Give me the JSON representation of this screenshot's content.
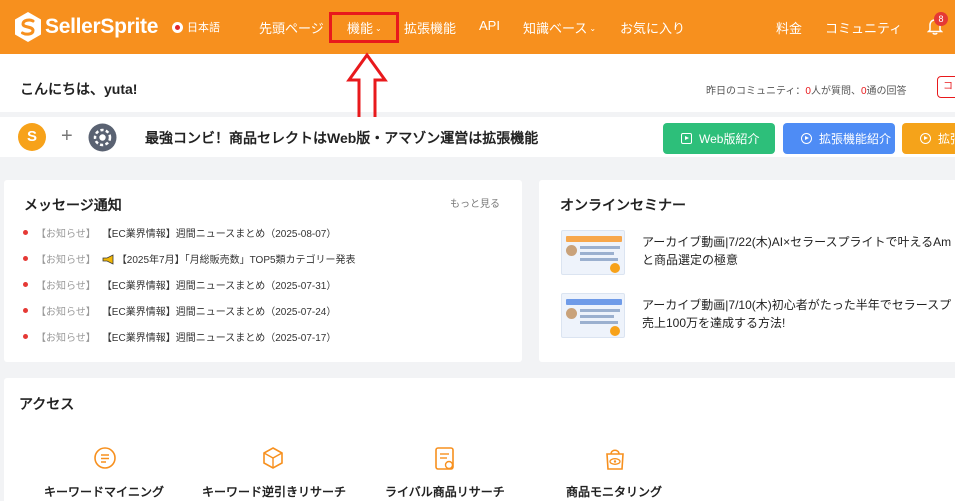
{
  "brand": {
    "name": "SellerSprite",
    "accent_color": "#f7901e",
    "highlight_color": "#e8191c"
  },
  "header": {
    "language": "日本語",
    "nav": [
      {
        "label": "先頭ページ"
      },
      {
        "label": "機能"
      },
      {
        "label": "拡張機能"
      },
      {
        "label": "API"
      },
      {
        "label": "知識ベース"
      },
      {
        "label": "お気に入り"
      },
      {
        "label": "料金"
      },
      {
        "label": "コミュニティ"
      }
    ],
    "notification_count": "8"
  },
  "greeting": {
    "text": "こんにちは、yuta!",
    "community_prefix": "昨日のコミュニティ：",
    "questions_count": "0",
    "questions_suffix": "人が質問、",
    "answers_count": "0",
    "answers_suffix": "通の回答",
    "edge_button": "コ"
  },
  "banner": {
    "plus": "+",
    "text": "最強コンビ！商品セレクトはWeb版・アマゾン運営は拡張機能",
    "buttons": [
      {
        "label": "Web版紹介",
        "color": "#2dbf7a"
      },
      {
        "label": "拡張機能紹介",
        "color": "#4e8cf5"
      },
      {
        "label": "拡張",
        "color": "#f5a31a"
      }
    ]
  },
  "messages": {
    "title": "メッセージ通知",
    "more": "もっと見る",
    "items": [
      {
        "tag": "【お知らせ】",
        "text": "【EC業界情報】週間ニュースまとめ（2025-08-07）"
      },
      {
        "tag": "【お知らせ】",
        "text": "【2025年7月】「月総販売数」TOP5類カテゴリー発表"
      },
      {
        "tag": "【お知らせ】",
        "text": "【EC業界情報】週間ニュースまとめ（2025-07-31）"
      },
      {
        "tag": "【お知らせ】",
        "text": "【EC業界情報】週間ニュースまとめ（2025-07-24）"
      },
      {
        "tag": "【お知らせ】",
        "text": "【EC業界情報】週間ニュースまとめ（2025-07-17）"
      }
    ]
  },
  "seminar": {
    "title": "オンラインセミナー",
    "items": [
      {
        "line1": "アーカイブ動画|7/22(木)AI×セラースプライトで叶えるAm",
        "line2": "と商品選定の極意"
      },
      {
        "line1": "アーカイブ動画|7/10(木)初心者がたった半年でセラースプ",
        "line2": "売上100万を達成する方法!"
      }
    ]
  },
  "access": {
    "title": "アクセス",
    "items": [
      {
        "label": "キーワードマイニング",
        "icon": "keyword-mining-icon"
      },
      {
        "label": "キーワード逆引きリサーチ",
        "icon": "reverse-lookup-icon"
      },
      {
        "label": "ライバル商品リサーチ",
        "icon": "competitor-research-icon"
      },
      {
        "label": "商品モニタリング",
        "icon": "product-monitoring-icon"
      }
    ]
  }
}
